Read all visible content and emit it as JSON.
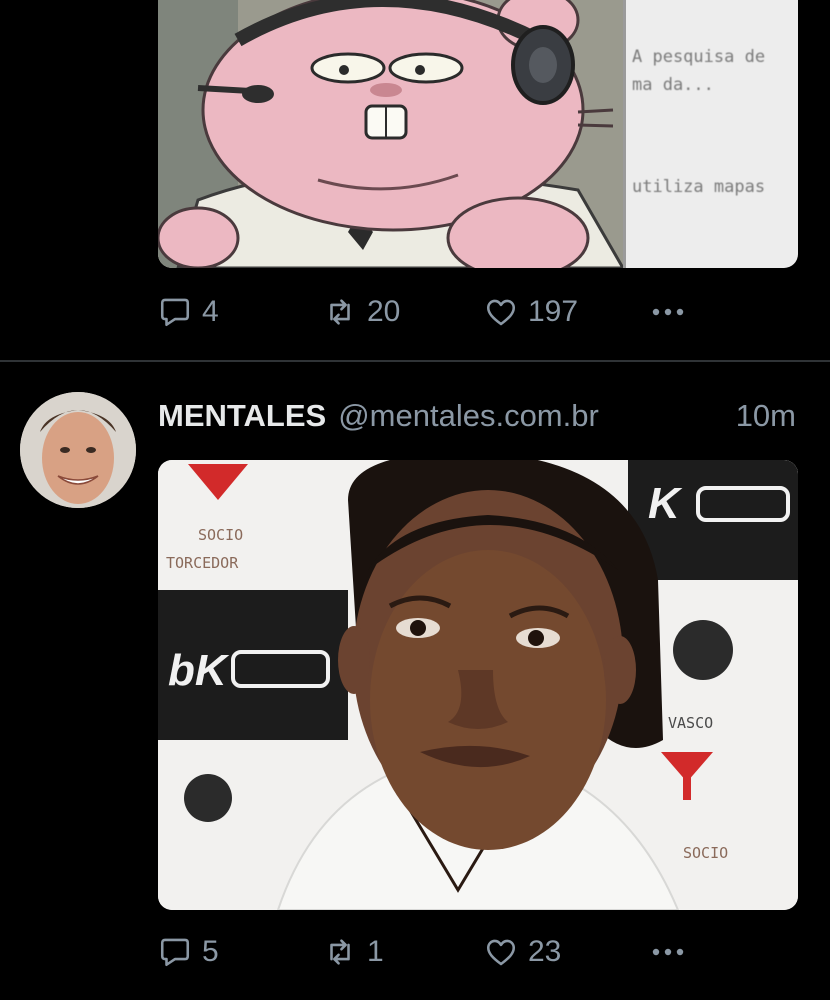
{
  "tweets": [
    {
      "media": {
        "side_text": [
          "A pesquisa de",
          "ma da...",
          "utiliza mapas"
        ]
      },
      "actions": {
        "replies": "4",
        "retweets": "20",
        "likes": "197"
      }
    },
    {
      "author": {
        "display_name": "MENTALES",
        "handle": "@mentales.com.br"
      },
      "time": "10m",
      "media": {
        "banner_texts": [
          "SOCIO",
          "TORCEDOR",
          "VASCO",
          "SOCIO"
        ]
      },
      "actions": {
        "replies": "5",
        "retweets": "1",
        "likes": "23"
      }
    }
  ],
  "colors": {
    "background": "#000000",
    "text_primary": "#e7e9ea",
    "text_secondary": "#8b98a5",
    "separator": "#2f3336"
  },
  "icons": [
    "reply-icon",
    "retweet-icon",
    "like-icon",
    "more-icon"
  ]
}
